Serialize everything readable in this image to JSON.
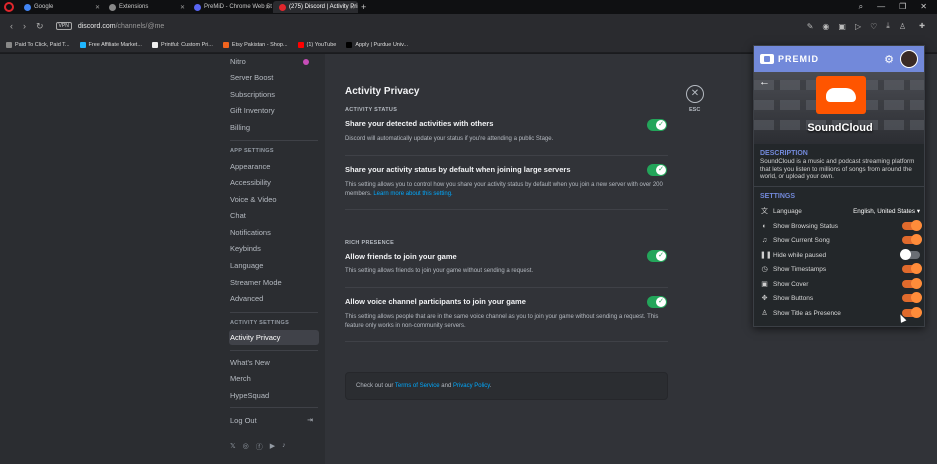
{
  "browser": {
    "tabs": [
      {
        "label": "Google",
        "color": "#4285f4",
        "active": false
      },
      {
        "label": "Extensions",
        "color": "#888888",
        "active": false
      },
      {
        "label": "PreMiD - Chrome Web St",
        "color": "#5865f2",
        "active": false
      },
      {
        "label": "(275) Discord | Activity Pri",
        "color": "#e0262c",
        "active": true
      }
    ],
    "vpn_label": "VPN",
    "url_domain": "discord.com",
    "url_path": "/channels/@me",
    "bookmarks": [
      "Paid To Click, Paid T...",
      "Free Affiliate Market...",
      "Printful: Custom Pri...",
      "Etsy Pakistan - Shop...",
      "(1) YouTube",
      "Apply | Purdue Univ..."
    ]
  },
  "menu": {
    "items_top": [
      "Nitro",
      "Server Boost",
      "Subscriptions",
      "Gift Inventory",
      "Billing"
    ],
    "header_app": "APP SETTINGS",
    "items_app": [
      "Appearance",
      "Accessibility",
      "Voice & Video",
      "Chat",
      "Notifications",
      "Keybinds",
      "Language",
      "Streamer Mode",
      "Advanced"
    ],
    "header_activity": "ACTIVITY SETTINGS",
    "active_item": "Activity Privacy",
    "items_bottom": [
      "What's New",
      "Merch",
      "HypeSquad"
    ],
    "logout": "Log Out"
  },
  "content": {
    "title": "Activity Privacy",
    "section_status": "ACTIVITY STATUS",
    "row1_title": "Share your detected activities with others",
    "row1_desc": "Discord will automatically update your status if you're attending a public Stage.",
    "row2_title": "Share your activity status by default when joining large servers",
    "row2_desc": "This setting allows you to control how you share your activity status by default when you join a new server with over 200 members.",
    "row2_link": "Learn more about this setting.",
    "section_rich": "RICH PRESENCE",
    "row3_title": "Allow friends to join your game",
    "row3_desc": "This setting allows friends to join your game without sending a request.",
    "row4_title": "Allow voice channel participants to join your game",
    "row4_desc": "This setting allows people that are in the same voice channel as you to join your game without sending a request. This feature only works in non-community servers.",
    "notice_prefix": "Check out our ",
    "notice_tos": "Terms of Service",
    "notice_and": " and ",
    "notice_pp": "Privacy Policy",
    "notice_end": ".",
    "esc_label": "ESC"
  },
  "premid": {
    "brand": "PREMID",
    "service_name": "SoundCloud",
    "desc_title": "DESCRIPTION",
    "desc": "SoundCloud is a music and podcast streaming platform that lets you listen to millions of songs from around the world, or upload your own.",
    "settings_title": "SETTINGS",
    "language_label": "Language",
    "language_value": "English, United States",
    "settings": [
      {
        "label": "Show Browsing Status",
        "icon": "eye-icon",
        "on": true
      },
      {
        "label": "Show Current Song",
        "icon": "music-note-icon",
        "on": true
      },
      {
        "label": "Hide while paused",
        "icon": "pause-icon",
        "on": false
      },
      {
        "label": "Show Timestamps",
        "icon": "clock-icon",
        "on": true
      },
      {
        "label": "Show Cover",
        "icon": "image-icon",
        "on": true
      },
      {
        "label": "Show Buttons",
        "icon": "buttons-icon",
        "on": true
      },
      {
        "label": "Show Title as Presence",
        "icon": "user-tag-icon",
        "on": true
      }
    ],
    "accent": "#7289da",
    "toggle_on_color": "#ff8c3a"
  }
}
